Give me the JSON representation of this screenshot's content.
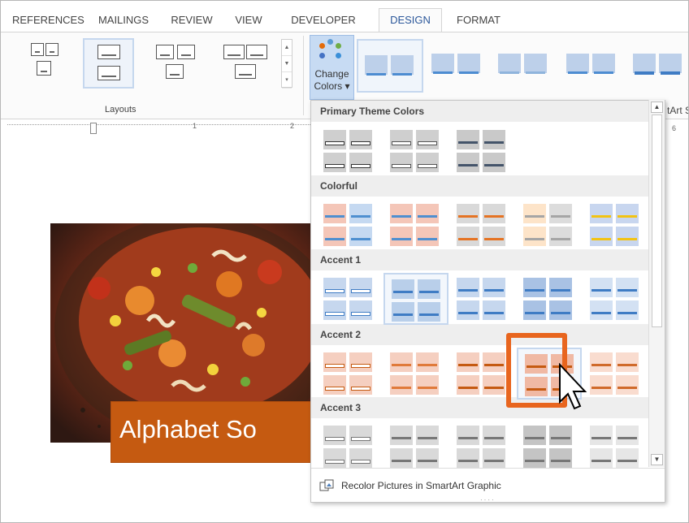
{
  "tabs": [
    {
      "label": "REFERENCES",
      "active": false
    },
    {
      "label": "MAILINGS",
      "active": false
    },
    {
      "label": "REVIEW",
      "active": false
    },
    {
      "label": "VIEW",
      "active": false
    },
    {
      "label": "DEVELOPER",
      "active": false
    },
    {
      "label": "DESIGN",
      "active": true
    },
    {
      "label": "FORMAT",
      "active": false
    }
  ],
  "ribbon": {
    "layouts_group_label": "Layouts",
    "change_colors_line1": "Change",
    "change_colors_line2": "Colors ▾",
    "smartart_group_partial": "tArt S"
  },
  "ruler": {
    "marks": [
      "1",
      "2"
    ],
    "right_mark": "6"
  },
  "document": {
    "title_text": "Alphabet So"
  },
  "dropdown": {
    "sections": [
      {
        "label": "Primary Theme Colors"
      },
      {
        "label": "Colorful"
      },
      {
        "label": "Accent 1"
      },
      {
        "label": "Accent 2"
      },
      {
        "label": "Accent 3"
      }
    ],
    "recolor_label": "Recolor Pictures in SmartArt Graphic",
    "grip": "····"
  },
  "colors": {
    "accent_blue": "#2b579a",
    "accent_orange": "#c55a11",
    "highlight": "#e8651e"
  },
  "icons": {
    "change_colors": "palette-dots-icon",
    "recolor": "recolor-pictures-icon",
    "cursor": "mouse-pointer-icon"
  }
}
